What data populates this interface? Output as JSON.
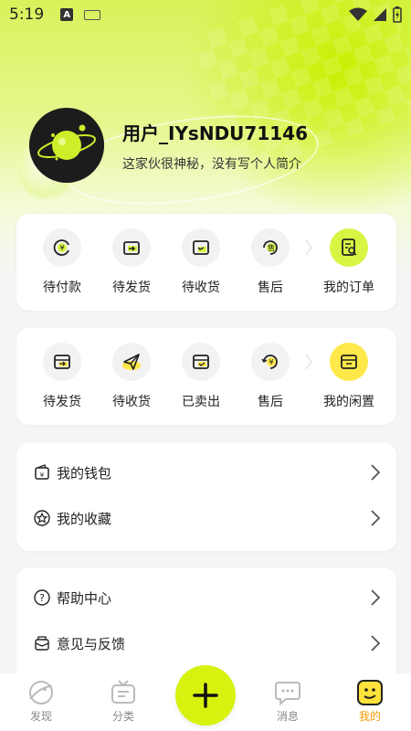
{
  "status_bar": {
    "time": "5:19",
    "a_icon": "A"
  },
  "profile": {
    "username": "用户_IYsNDU71146",
    "bio": "这家伙很神秘，没有写个人简介"
  },
  "orders": {
    "items": [
      {
        "label": "待付款",
        "icon": "yen-circle-icon"
      },
      {
        "label": "待发货",
        "icon": "box-arrow-icon"
      },
      {
        "label": "待收货",
        "icon": "box-clock-icon"
      },
      {
        "label": "售后",
        "icon": "refund-icon"
      }
    ],
    "main": {
      "label": "我的订单",
      "icon": "order-search-icon"
    }
  },
  "idle": {
    "items": [
      {
        "label": "待发货",
        "icon": "box-arrow-icon"
      },
      {
        "label": "待收货",
        "icon": "send-icon"
      },
      {
        "label": "已卖出",
        "icon": "box-check-icon"
      },
      {
        "label": "售后",
        "icon": "yen-refresh-icon"
      }
    ],
    "main": {
      "label": "我的闲置",
      "icon": "box-icon"
    }
  },
  "menu1": [
    {
      "label": "我的钱包",
      "icon": "wallet-icon"
    },
    {
      "label": "我的收藏",
      "icon": "star-icon"
    }
  ],
  "menu2": [
    {
      "label": "帮助中心",
      "icon": "help-icon"
    },
    {
      "label": "意见与反馈",
      "icon": "feedback-icon"
    }
  ],
  "nav": {
    "items": [
      {
        "label": "发现",
        "icon": "compass-icon"
      },
      {
        "label": "分类",
        "icon": "tv-icon"
      },
      {
        "label": "消息",
        "icon": "chat-icon"
      },
      {
        "label": "我的",
        "icon": "face-icon"
      }
    ],
    "active": "我的"
  },
  "colors": {
    "accent": "#d7f20f",
    "active_nav": "#f29c00",
    "highlight_yellow": "#ffe84a"
  }
}
